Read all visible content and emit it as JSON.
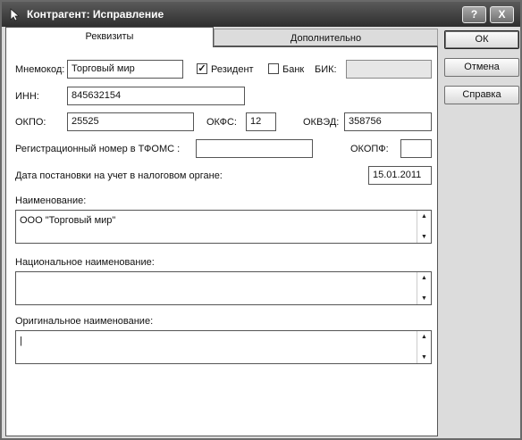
{
  "window": {
    "title": "Контрагент: Исправление",
    "help_btn": "?",
    "close_btn": "X"
  },
  "tabs": [
    "Реквизиты",
    "Дополнительно"
  ],
  "form": {
    "mnemokod_label": "Мнемокод:",
    "mnemokod_value": "Торговый мир",
    "resident_label": "Резидент",
    "resident_checked": true,
    "bank_label": "Банк",
    "bank_checked": false,
    "bik_label": "БИК:",
    "bik_value": "",
    "inn_label": "ИНН:",
    "inn_value": "845632154",
    "okpo_label": "ОКПО:",
    "okpo_value": "25525",
    "okfs_label": "ОКФС:",
    "okfs_value": "12",
    "okved_label": "ОКВЭД:",
    "okved_value": "358756",
    "reg_tfoms_label": "Регистрационный номер в ТФОМС :",
    "reg_tfoms_value": "",
    "okopf_label": "ОКОПФ:",
    "okopf_value": "",
    "tax_date_label": "Дата постановки на учет в налоговом органе:",
    "tax_date_value": "15.01.2011",
    "name_label": "Наименование:",
    "name_value": "ООО \"Торговый мир\"",
    "national_name_label": "Национальное наименование:",
    "national_name_value": "",
    "original_name_label": "Оригинальное наименование:",
    "original_name_value": "|"
  },
  "buttons": {
    "ok": "ОК",
    "cancel": "Отмена",
    "help": "Справка"
  },
  "icons": {
    "title": "cursor-arrow-icon",
    "scroll_up": "scroll-up-arrow-icon",
    "scroll_down": "scroll-down-arrow-icon"
  },
  "colors": {
    "titlebar": "#3a3a3a",
    "panel": "#ffffff",
    "dialog": "#dcdcdc"
  }
}
